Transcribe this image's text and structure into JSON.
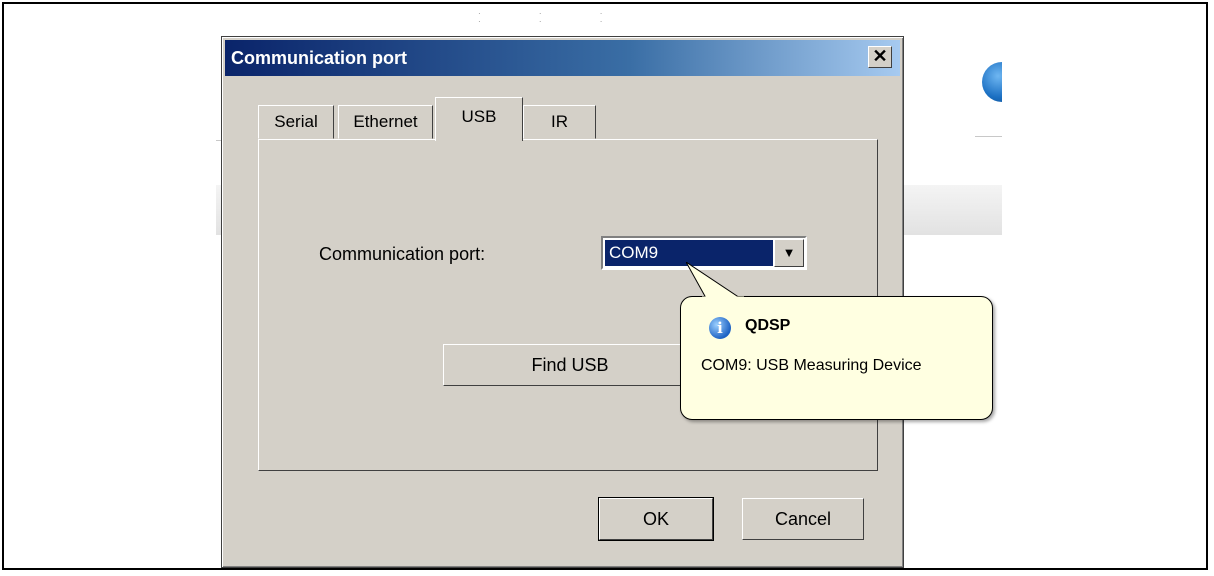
{
  "dialog": {
    "title": "Communication port",
    "close_label": "✕",
    "tabs": [
      {
        "label": "Serial",
        "active": false
      },
      {
        "label": "Ethernet",
        "active": false
      },
      {
        "label": "USB",
        "active": true
      },
      {
        "label": "IR",
        "active": false
      }
    ],
    "comm_port_label": "Communication port:",
    "comm_port_value": "COM9",
    "find_usb_label": "Find USB",
    "ok_label": "OK",
    "cancel_label": "Cancel"
  },
  "tooltip": {
    "icon": "info-icon",
    "title": "QDSP",
    "text": "COM9: USB Measuring Device"
  },
  "colors": {
    "titlebar_start": "#0a246a",
    "titlebar_end": "#a6caf0",
    "dialog_bg": "#d4d0c8",
    "selection": "#0a246a",
    "balloon_bg": "#ffffe1"
  }
}
